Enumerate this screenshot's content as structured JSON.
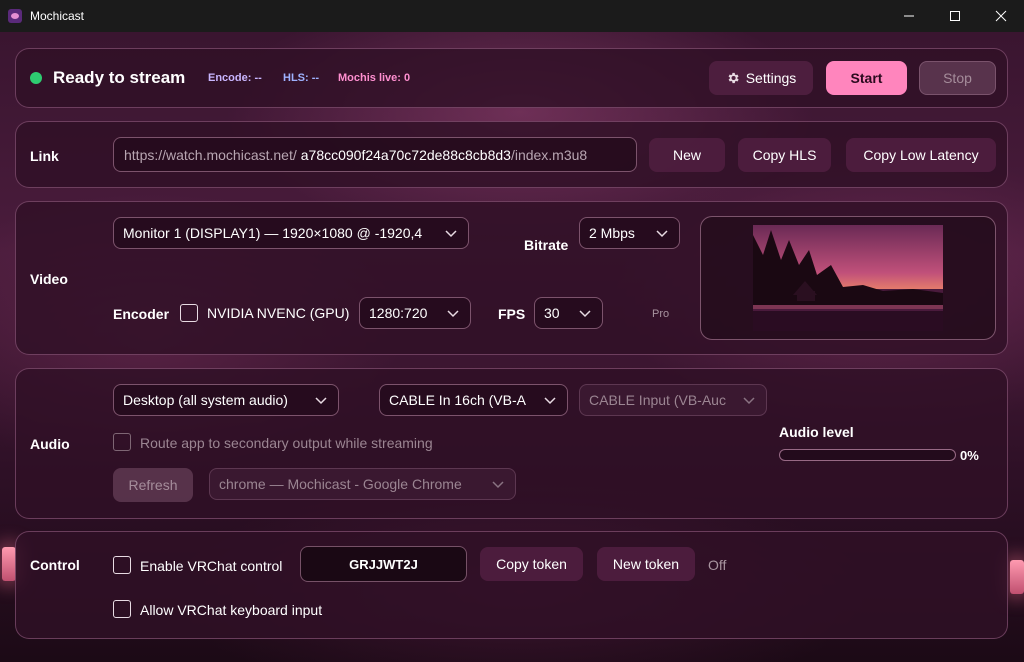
{
  "window": {
    "title": "Mochicast",
    "minimize": "—",
    "maximize": "☐",
    "close": "✕"
  },
  "status": {
    "text": "Ready to stream",
    "indicator_color": "#2ecc71",
    "encode": "Encode: --",
    "hls": "HLS: --",
    "mochis": "Mochis live: 0",
    "settings_label": "Settings",
    "start_label": "Start",
    "stop_label": "Stop"
  },
  "link": {
    "label": "Link",
    "prefix": "https://watch.mochicast.net/",
    "token": "a78cc090f24a70c72de88c8cb8d3",
    "suffix": "/index.m3u8",
    "new_label": "New",
    "copy_hls_label": "Copy HLS",
    "copy_low_latency_label": "Copy Low Latency"
  },
  "video": {
    "label": "Video",
    "monitor": "Monitor 1 (DISPLAY1) — 1920×1080 @ -1920,4",
    "bitrate_label": "Bitrate",
    "bitrate": "2 Mbps",
    "encoder_label": "Encoder",
    "nvenc_label": "NVIDIA NVENC (GPU)",
    "nvenc_checked": false,
    "resolution": "1280:720",
    "fps_label": "FPS",
    "fps": "30",
    "pro_label": "Pro"
  },
  "audio": {
    "label": "Audio",
    "source": "Desktop (all system audio)",
    "output_device": "CABLE In 16ch (VB-A",
    "secondary_device": "CABLE Input (VB-Auc",
    "route_label": "Route app to secondary output while streaming",
    "refresh_label": "Refresh",
    "app": "chrome — Mochicast - Google Chrome",
    "level_label": "Audio level",
    "level_percent": "0%",
    "level_value": 0
  },
  "control": {
    "label": "Control",
    "enable_vrchat_label": "Enable VRChat control",
    "token": "GRJJWT2J",
    "copy_token_label": "Copy token",
    "new_token_label": "New token",
    "state": "Off",
    "keyboard_label": "Allow VRChat keyboard input"
  },
  "colors": {
    "accent": "#ff7fb8",
    "encode": "#c9b6ff",
    "hls": "#9fb2ff",
    "mochis": "#ff8fd0"
  }
}
